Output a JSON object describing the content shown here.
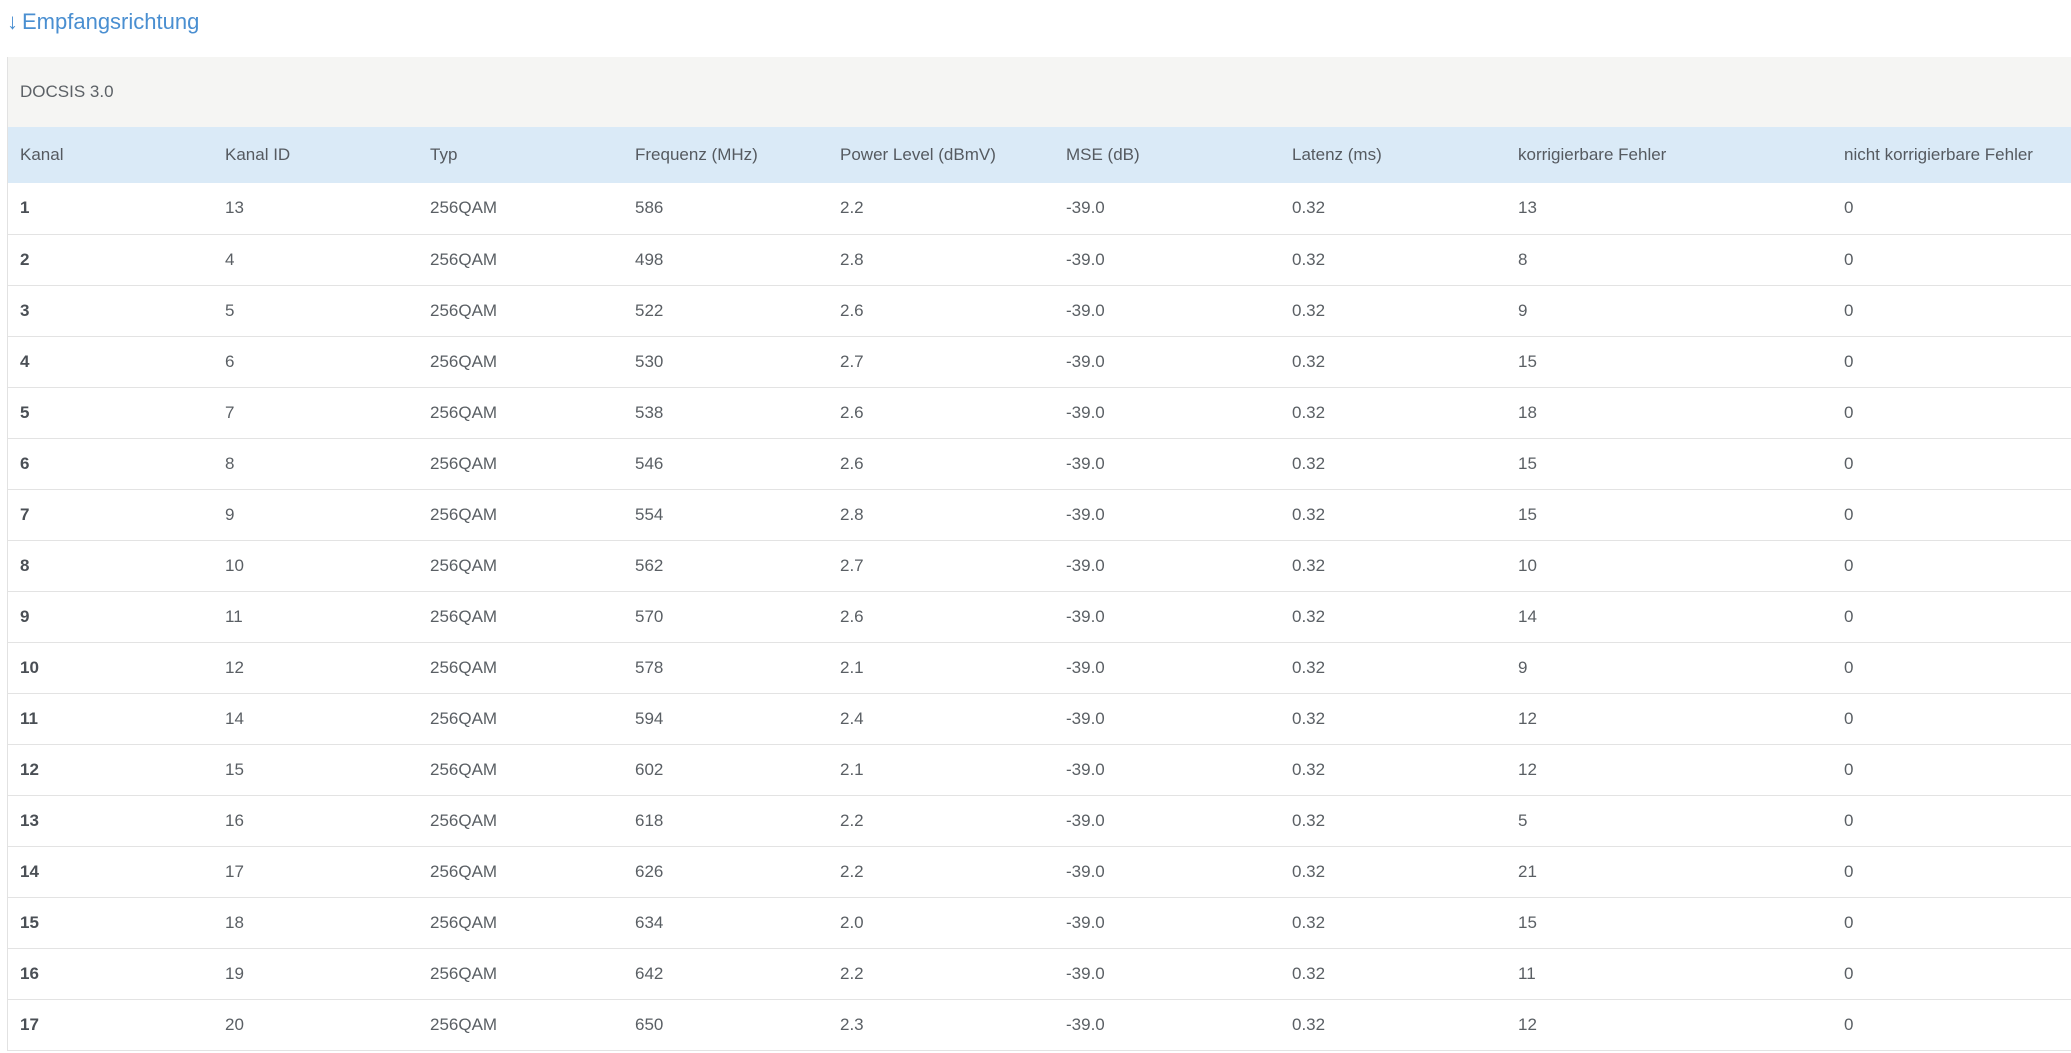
{
  "heading": {
    "arrow": "↓",
    "label": "Empfangsrichtung"
  },
  "panel": {
    "title": "DOCSIS 3.0"
  },
  "table": {
    "columns": [
      "Kanal",
      "Kanal ID",
      "Typ",
      "Frequenz (MHz)",
      "Power Level (dBmV)",
      "MSE (dB)",
      "Latenz (ms)",
      "korrigierbare Fehler",
      "nicht korrigierbare Fehler"
    ],
    "rows": [
      [
        "1",
        "13",
        "256QAM",
        "586",
        "2.2",
        "-39.0",
        "0.32",
        "13",
        "0"
      ],
      [
        "2",
        "4",
        "256QAM",
        "498",
        "2.8",
        "-39.0",
        "0.32",
        "8",
        "0"
      ],
      [
        "3",
        "5",
        "256QAM",
        "522",
        "2.6",
        "-39.0",
        "0.32",
        "9",
        "0"
      ],
      [
        "4",
        "6",
        "256QAM",
        "530",
        "2.7",
        "-39.0",
        "0.32",
        "15",
        "0"
      ],
      [
        "5",
        "7",
        "256QAM",
        "538",
        "2.6",
        "-39.0",
        "0.32",
        "18",
        "0"
      ],
      [
        "6",
        "8",
        "256QAM",
        "546",
        "2.6",
        "-39.0",
        "0.32",
        "15",
        "0"
      ],
      [
        "7",
        "9",
        "256QAM",
        "554",
        "2.8",
        "-39.0",
        "0.32",
        "15",
        "0"
      ],
      [
        "8",
        "10",
        "256QAM",
        "562",
        "2.7",
        "-39.0",
        "0.32",
        "10",
        "0"
      ],
      [
        "9",
        "11",
        "256QAM",
        "570",
        "2.6",
        "-39.0",
        "0.32",
        "14",
        "0"
      ],
      [
        "10",
        "12",
        "256QAM",
        "578",
        "2.1",
        "-39.0",
        "0.32",
        "9",
        "0"
      ],
      [
        "11",
        "14",
        "256QAM",
        "594",
        "2.4",
        "-39.0",
        "0.32",
        "12",
        "0"
      ],
      [
        "12",
        "15",
        "256QAM",
        "602",
        "2.1",
        "-39.0",
        "0.32",
        "12",
        "0"
      ],
      [
        "13",
        "16",
        "256QAM",
        "618",
        "2.2",
        "-39.0",
        "0.32",
        "5",
        "0"
      ],
      [
        "14",
        "17",
        "256QAM",
        "626",
        "2.2",
        "-39.0",
        "0.32",
        "21",
        "0"
      ],
      [
        "15",
        "18",
        "256QAM",
        "634",
        "2.0",
        "-39.0",
        "0.32",
        "15",
        "0"
      ],
      [
        "16",
        "19",
        "256QAM",
        "642",
        "2.2",
        "-39.0",
        "0.32",
        "11",
        "0"
      ],
      [
        "17",
        "20",
        "256QAM",
        "650",
        "2.3",
        "-39.0",
        "0.32",
        "12",
        "0"
      ]
    ]
  }
}
